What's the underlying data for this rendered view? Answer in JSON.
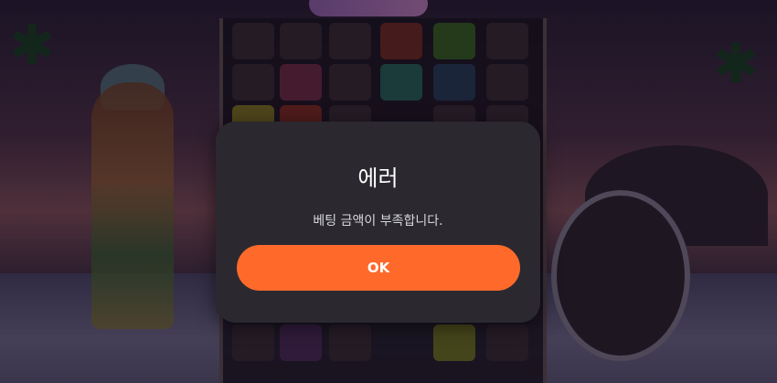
{
  "dialog": {
    "title": "에러",
    "message": "베팅 금액이 부족합니다.",
    "ok_label": "OK"
  },
  "colors": {
    "dialog_bg": "#2b292f",
    "button_bg": "#ff6a2b",
    "title_text": "#ffffff",
    "message_text": "#d6d6da"
  }
}
